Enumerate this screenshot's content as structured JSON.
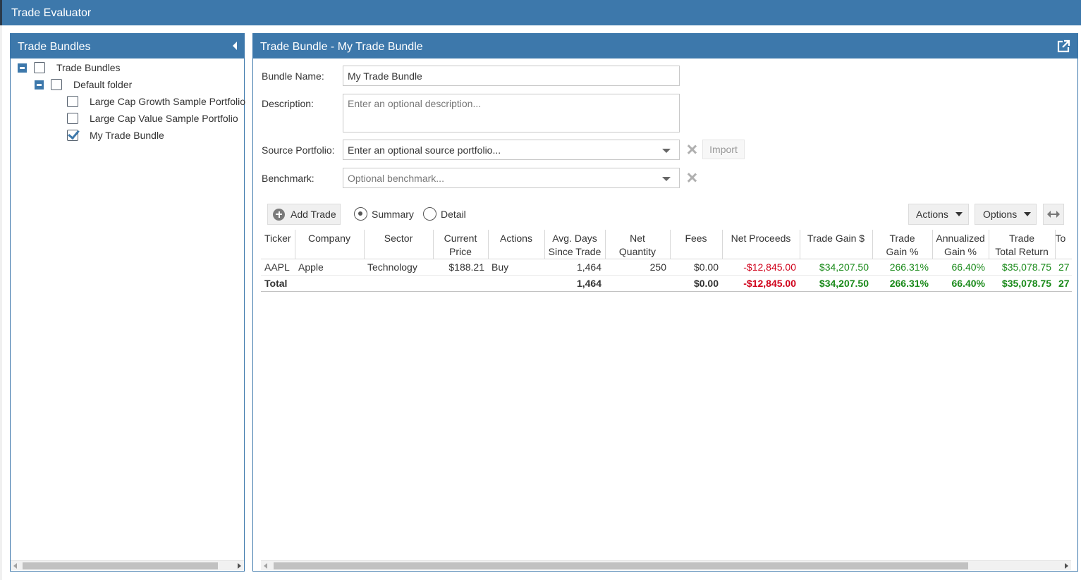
{
  "app": {
    "title": "Trade Evaluator"
  },
  "left_panel": {
    "title": "Trade Bundles",
    "tree": [
      {
        "label": "Trade Bundles",
        "expanded": true,
        "checked": false
      },
      {
        "label": "Default folder",
        "expanded": true,
        "checked": false
      },
      {
        "label": "Large Cap Growth Sample Portfolio",
        "checked": false
      },
      {
        "label": "Large Cap Value Sample Portfolio",
        "checked": false
      },
      {
        "label": "My Trade Bundle",
        "checked": true
      }
    ]
  },
  "right_panel": {
    "title": "Trade Bundle - My Trade Bundle",
    "form": {
      "bundle_name_label": "Bundle Name:",
      "bundle_name_value": "My Trade Bundle",
      "description_label": "Description:",
      "description_placeholder": "Enter an optional description...",
      "source_portfolio_label": "Source Portfolio:",
      "source_portfolio_value": "Enter an optional source portfolio...",
      "import_label": "Import",
      "benchmark_label": "Benchmark:",
      "benchmark_placeholder": "Optional benchmark..."
    },
    "toolbar": {
      "add_trade_label": "Add Trade",
      "summary_label": "Summary",
      "detail_label": "Detail",
      "view_mode": "Summary",
      "actions_label": "Actions",
      "options_label": "Options"
    },
    "grid": {
      "columns": [
        {
          "line1": "Ticker",
          "line2": ""
        },
        {
          "line1": "Company",
          "line2": ""
        },
        {
          "line1": "Sector",
          "line2": ""
        },
        {
          "line1": "Current",
          "line2": "Price"
        },
        {
          "line1": "Actions",
          "line2": ""
        },
        {
          "line1": "Avg. Days",
          "line2": "Since Trade"
        },
        {
          "line1": "Net",
          "line2": "Quantity"
        },
        {
          "line1": "Fees",
          "line2": ""
        },
        {
          "line1": "Net Proceeds",
          "line2": ""
        },
        {
          "line1": "Trade Gain $",
          "line2": ""
        },
        {
          "line1": "Trade",
          "line2": "Gain %"
        },
        {
          "line1": "Annualized",
          "line2": "Gain %"
        },
        {
          "line1": "Trade",
          "line2": "Total Return"
        },
        {
          "line1": "To",
          "line2": ""
        }
      ],
      "rows": [
        {
          "ticker": "AAPL",
          "company": "Apple",
          "sector": "Technology",
          "current_price": "$188.21",
          "actions": "Buy",
          "avg_days": "1,464",
          "net_quantity": "250",
          "fees": "$0.00",
          "net_proceeds": "-$12,845.00",
          "trade_gain": "$34,207.50",
          "trade_gain_pct": "266.31%",
          "annualized_gain_pct": "66.40%",
          "trade_total_return": "$35,078.75",
          "extra": "27"
        }
      ],
      "total": {
        "label": "Total",
        "avg_days": "1,464",
        "fees": "$0.00",
        "net_proceeds": "-$12,845.00",
        "trade_gain": "$34,207.50",
        "trade_gain_pct": "266.31%",
        "annualized_gain_pct": "66.40%",
        "trade_total_return": "$35,078.75",
        "extra": "27"
      }
    }
  },
  "colors": {
    "header": "#3d78ab",
    "negative": "#d0021b",
    "positive": "#1a8a1a"
  }
}
